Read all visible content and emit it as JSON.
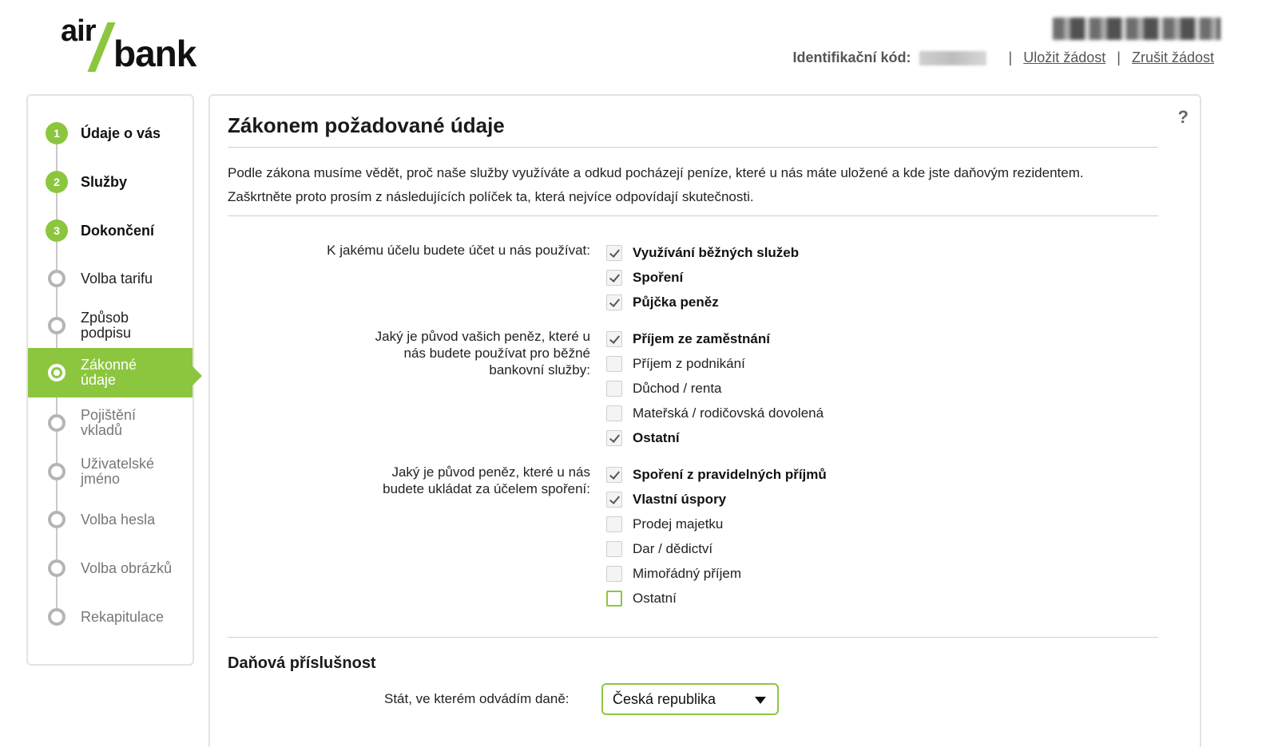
{
  "brand": {
    "logo_air": "air",
    "logo_bank": "bank",
    "accent": "#8cc63f"
  },
  "header": {
    "id_label": "Identifikační kód:",
    "save_link": "Uložit žádost",
    "cancel_link": "Zrušit žádost",
    "separator": "|"
  },
  "sidebar": {
    "steps": [
      {
        "number": "1",
        "label": "Údaje o vás",
        "kind": "major"
      },
      {
        "number": "2",
        "label": "Služby",
        "kind": "major"
      },
      {
        "number": "3",
        "label": "Dokončení",
        "kind": "major"
      },
      {
        "label": "Volba tarifu",
        "state": "done"
      },
      {
        "label": "Způsob podpisu",
        "state": "done"
      },
      {
        "label": "Zákonné údaje",
        "state": "active"
      },
      {
        "label": "Pojištění vkladů",
        "state": "todo"
      },
      {
        "label": "Uživatelské jméno",
        "state": "todo"
      },
      {
        "label": "Volba hesla",
        "state": "todo"
      },
      {
        "label": "Volba obrázků",
        "state": "todo"
      },
      {
        "label": "Rekapitulace",
        "state": "todo"
      }
    ]
  },
  "main": {
    "help_icon": "?",
    "title": "Zákonem požadované údaje",
    "intro_line1": "Podle zákona musíme vědět, proč naše služby využíváte a odkud pocházejí peníze, které u nás máte uložené a kde jste daňovým rezidentem.",
    "intro_line2": "Zaškrtněte proto prosím z následujících políček ta, která nejvíce odpovídají skutečnosti.",
    "questions": [
      {
        "label": "K jakému účelu budete účet u nás používat:",
        "options": [
          {
            "label": "Využívání běžných služeb",
            "checked": true
          },
          {
            "label": "Spoření",
            "checked": true
          },
          {
            "label": "Půjčka peněz",
            "checked": true
          }
        ]
      },
      {
        "label": "Jaký je původ vašich peněz, které u nás budete používat pro běžné bankovní služby:",
        "options": [
          {
            "label": "Příjem ze zaměstnání",
            "checked": true
          },
          {
            "label": "Příjem z podnikání",
            "checked": false
          },
          {
            "label": "Důchod / renta",
            "checked": false
          },
          {
            "label": "Mateřská / rodičovská dovolená",
            "checked": false
          },
          {
            "label": "Ostatní",
            "checked": true
          }
        ]
      },
      {
        "label": "Jaký je původ peněz, které u nás budete ukládat za účelem spoření:",
        "options": [
          {
            "label": "Spoření z pravidelných příjmů",
            "checked": true
          },
          {
            "label": "Vlastní úspory",
            "checked": true
          },
          {
            "label": "Prodej majetku",
            "checked": false
          },
          {
            "label": "Dar / dědictví",
            "checked": false
          },
          {
            "label": "Mimořádný příjem",
            "checked": false
          },
          {
            "label": "Ostatní",
            "checked": false
          }
        ]
      }
    ],
    "tax": {
      "title": "Daňová příslušnost",
      "label": "Stát, ve kterém odvádím daně:",
      "selected": "Česká republika"
    }
  }
}
